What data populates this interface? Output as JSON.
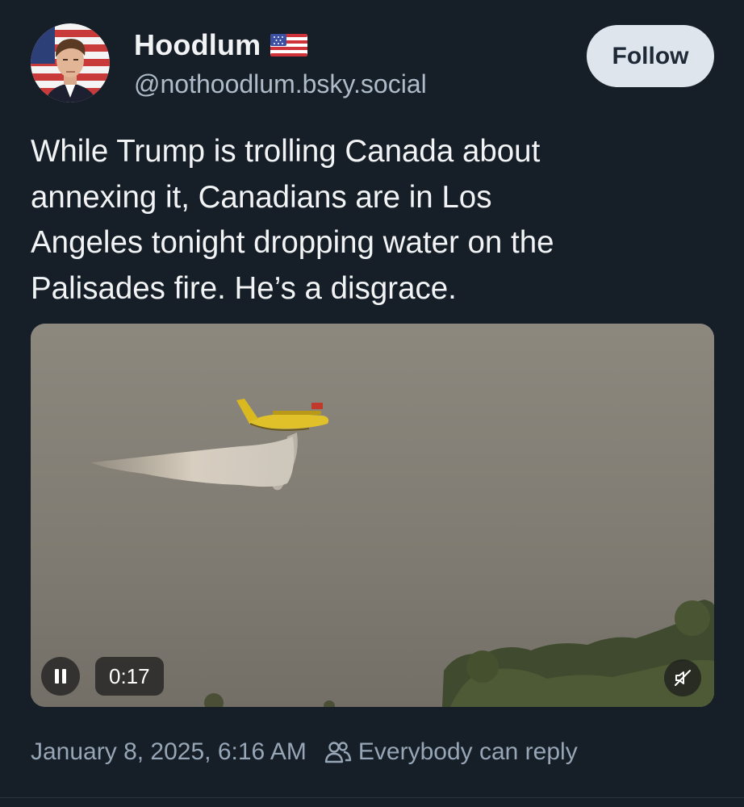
{
  "author": {
    "display_name": "Hoodlum",
    "flag_icon": "us-flag-icon",
    "handle": "@nothoodlum.bsky.social"
  },
  "follow_label": "Follow",
  "post": {
    "text": "While Trump is trolling Canada about\nannexing it, Canadians are in Los\nAngeles tonight dropping water on the\nPalisades fire. He’s a disgrace."
  },
  "video": {
    "elapsed": "0:17",
    "state": "playing",
    "muted": true,
    "pause_icon": "pause-icon",
    "mute_icon": "speaker-muted-icon"
  },
  "meta": {
    "timestamp": "January 8, 2025, 6:16 AM",
    "reply_icon": "people-icon",
    "reply_setting": "Everybody can reply"
  },
  "colors": {
    "background": "#161e27",
    "text": "#f1f3f5",
    "muted_text": "#97a6b6",
    "follow_bg": "#dfe5ec",
    "follow_text": "#1d2936"
  }
}
